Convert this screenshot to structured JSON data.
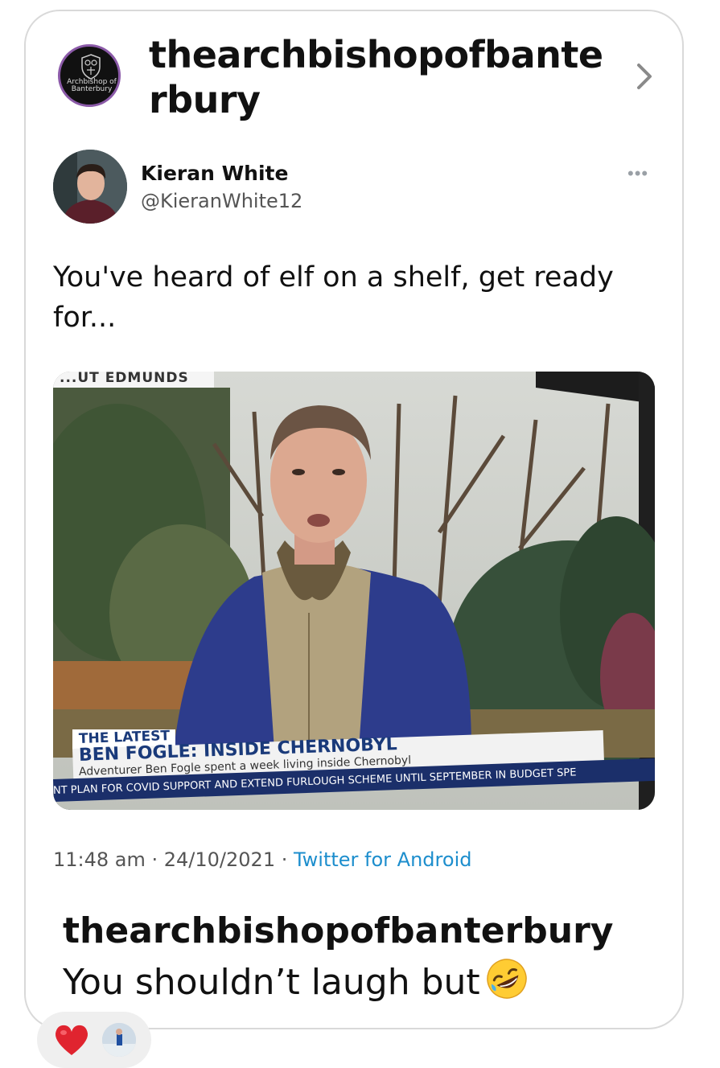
{
  "post": {
    "account": "thearchbishopofbanterbury",
    "avatar_logo_text": "Archbishop of Banterbury",
    "icons": {
      "chevron": "chevron-right-icon",
      "more": "more-options-icon"
    }
  },
  "tweet": {
    "author_name": "Kieran White",
    "author_handle": "@KieranWhite12",
    "more_label": "•••",
    "text": "You've heard of elf on a shelf, get ready for...",
    "meta_time": "11:48 am · 24/10/2021 · ",
    "meta_source": "Twitter for Android"
  },
  "media": {
    "top_banner": "...UT EDMUNDS",
    "lower_third_tag": "THE LATEST",
    "headline": "BEN FOGLE: INSIDE CHERNOBYL",
    "subline": "Adventurer Ben Fogle spent a week living inside Chernobyl",
    "ticker": "NT PLAN FOR COVID SUPPORT AND EXTEND FURLOUGH SCHEME UNTIL SEPTEMBER IN BUDGET SPE"
  },
  "caption": {
    "username": "thearchbishopofbanterbury",
    "text": "You shouldn’t laugh but",
    "emoji": "rolling-on-floor-laughing-emoji"
  },
  "reactions": {
    "heart": "red-heart-icon",
    "avatar": "reactor-avatar"
  },
  "colors": {
    "card_border": "#d9d9d9",
    "link_blue": "#1d8ecd",
    "avatar_ring": "#8b5aa8",
    "tv_headline": "#1a3a7a"
  }
}
